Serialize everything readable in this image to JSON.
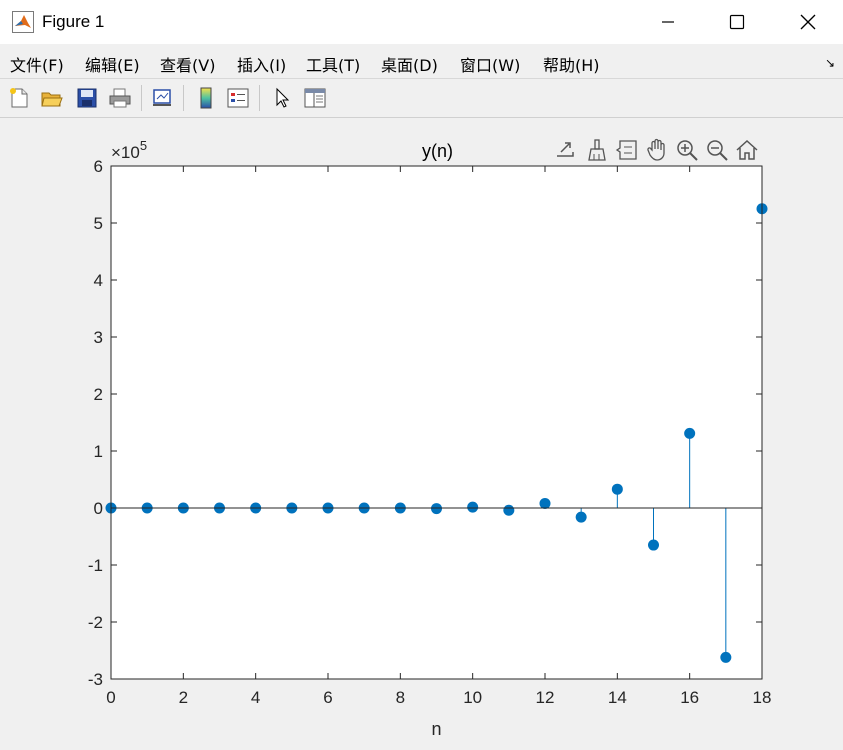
{
  "window": {
    "title": "Figure 1"
  },
  "menu": {
    "items": [
      "文件(F)",
      "编辑(E)",
      "查看(V)",
      "插入(I)",
      "工具(T)",
      "桌面(D)",
      "窗口(W)",
      "帮助(H)"
    ]
  },
  "toolbar": {
    "icons": [
      "new-figure-icon",
      "open-file-icon",
      "save-icon",
      "print-icon",
      "link-plot-icon",
      "colorbar-icon",
      "legend-icon",
      "edit-plot-icon",
      "property-inspector-icon"
    ]
  },
  "axes_toolbar": {
    "icons": [
      "export-icon",
      "brush-icon",
      "data-tips-icon",
      "pan-icon",
      "zoom-in-icon",
      "zoom-out-icon",
      "home-icon"
    ]
  },
  "colors": {
    "stem": "#0072bd",
    "axes_bg": "#ffffff",
    "figure_bg": "#f0f0f0",
    "axis_line": "#262626"
  },
  "chart_data": {
    "type": "stem",
    "title": "y(n)",
    "xlabel": "n",
    "ylabel": "",
    "exponent_label": "×10",
    "exponent_power": "5",
    "xlim": [
      0,
      18
    ],
    "ylim": [
      -300000,
      600000
    ],
    "xticks": [
      "0",
      "2",
      "4",
      "6",
      "8",
      "10",
      "12",
      "14",
      "16",
      "18"
    ],
    "yticks": [
      "-3",
      "-2",
      "-1",
      "0",
      "1",
      "2",
      "3",
      "4",
      "5",
      "6"
    ],
    "grid": false,
    "x": [
      0,
      1,
      2,
      3,
      4,
      5,
      6,
      7,
      8,
      9,
      10,
      11,
      12,
      13,
      14,
      15,
      16,
      17,
      18
    ],
    "values": [
      0,
      0,
      0,
      0,
      0,
      0,
      0,
      0,
      0,
      -1000,
      1500,
      -4000,
      8000,
      -16000,
      33000,
      -65000,
      131000,
      -262000,
      525000
    ]
  }
}
